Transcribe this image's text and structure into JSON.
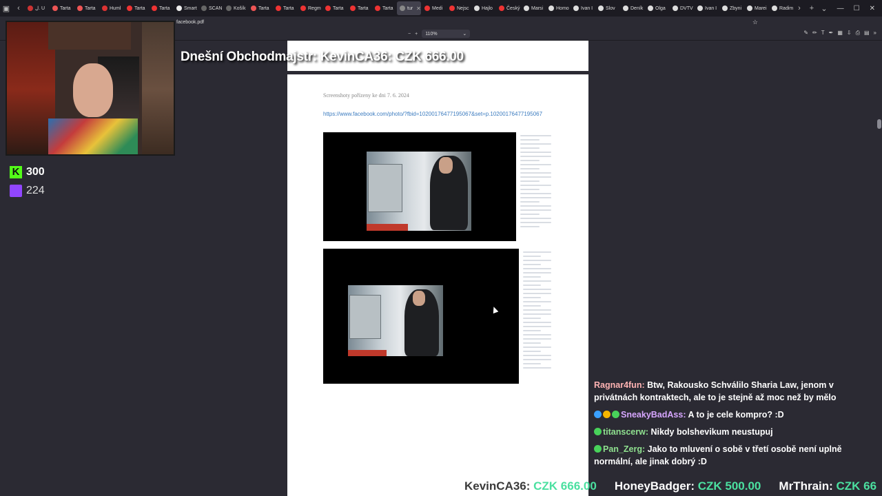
{
  "browser": {
    "tabs": [
      {
        "label": "ل. U",
        "color": "#c33"
      },
      {
        "label": "Tarta",
        "color": "#e55"
      },
      {
        "label": "Tarta",
        "color": "#e55"
      },
      {
        "label": "Huml",
        "color": "#d33"
      },
      {
        "label": "Tarta",
        "color": "#e33"
      },
      {
        "label": "Tarta",
        "color": "#e33"
      },
      {
        "label": "Smart",
        "color": "#eee"
      },
      {
        "label": "SCAN",
        "color": "#666"
      },
      {
        "label": "Košík",
        "color": "#666"
      },
      {
        "label": "Tarta",
        "color": "#e55"
      },
      {
        "label": "Tarta",
        "color": "#e33"
      },
      {
        "label": "Regm",
        "color": "#e33"
      },
      {
        "label": "Tarta",
        "color": "#e33"
      },
      {
        "label": "Tarta",
        "color": "#e33"
      },
      {
        "label": "Tarta",
        "color": "#e33"
      },
      {
        "label": "tur",
        "color": "#888",
        "active": true
      },
      {
        "label": "Medi",
        "color": "#e33"
      },
      {
        "label": "Nejsc",
        "color": "#e33"
      },
      {
        "label": "Hajlo",
        "color": "#ddd"
      },
      {
        "label": "Český",
        "color": "#e33"
      },
      {
        "label": "Marsi",
        "color": "#ddd"
      },
      {
        "label": "Homo",
        "color": "#ddd"
      },
      {
        "label": "Ivan I",
        "color": "#ddd"
      },
      {
        "label": "Slov",
        "color": "#ddd"
      },
      {
        "label": "Deník",
        "color": "#ddd"
      },
      {
        "label": "Olga",
        "color": "#ddd"
      },
      {
        "label": "DVTV",
        "color": "#ddd"
      },
      {
        "label": "Ivan I",
        "color": "#ddd"
      },
      {
        "label": "Zbyni",
        "color": "#ddd"
      },
      {
        "label": "Marei",
        "color": "#ddd"
      },
      {
        "label": "Radim",
        "color": "#ddd"
      }
    ],
    "file_name": "facebook.pdf",
    "zoom": "110%"
  },
  "pdf": {
    "caption": "Screenshoty pořízeny ke dni 7. 6. 2024",
    "link": "https://www.facebook.com/photo/?fbid=10200176477195067&set=p.10200176477195067"
  },
  "overlay": {
    "title": "Dnešní Obchodmajstr: KevinCA36: CZK 666.00",
    "kick_count": "300",
    "twitch_count": "224"
  },
  "chat": [
    {
      "user": "Ragnar4fun:",
      "color": "#ffb3b3",
      "text": " Btw, Rakousko Schválilo Sharia Law, jenom v privátnách kontraktech, ale to je stejně až moc než by mělo",
      "badges": []
    },
    {
      "user": "SneakyBadAss:",
      "color": "#d7a6ff",
      "text": " A to je cele kompro? :D",
      "badges": [
        "#3aa0ff",
        "#f5b400",
        "#48d25a"
      ]
    },
    {
      "user": "titanscerw:",
      "color": "#8fe08f",
      "text": " Nikdy bolshevikum neustupuj",
      "badges": [
        "#48d25a"
      ]
    },
    {
      "user": "Pan_Zerg:",
      "color": "#8fe08f",
      "text": " Jako to mluvení o sobě v třetí osobě není uplně normální, ale jinak dobrý :D",
      "badges": [
        "#48d25a"
      ]
    }
  ],
  "ticker": [
    {
      "name": "KevinCA36:",
      "amount": "CZK 666.00"
    },
    {
      "name": "HoneyBadger:",
      "amount": "CZK 500.00"
    },
    {
      "name": "MrThrain:",
      "amount": "CZK 66"
    }
  ]
}
